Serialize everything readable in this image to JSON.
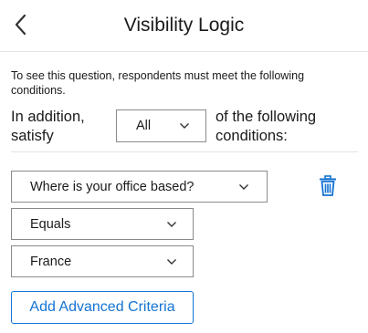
{
  "header": {
    "title": "Visibility Logic",
    "back_icon": "chevron-left-icon"
  },
  "intro_text": "To see this question, respondents must meet the following conditions.",
  "satisfy": {
    "prefix": "In addition,\nsatisfy",
    "selected": "All",
    "suffix": "of the following\nconditions:"
  },
  "condition": {
    "question": "Where is your office based?",
    "operator": "Equals",
    "value": "France",
    "delete_icon": "trash-icon"
  },
  "add_button_label": "Add Advanced Criteria",
  "colors": {
    "accent": "#1473d3",
    "border": "#8a8a8a",
    "divider": "#e3e3e3"
  }
}
